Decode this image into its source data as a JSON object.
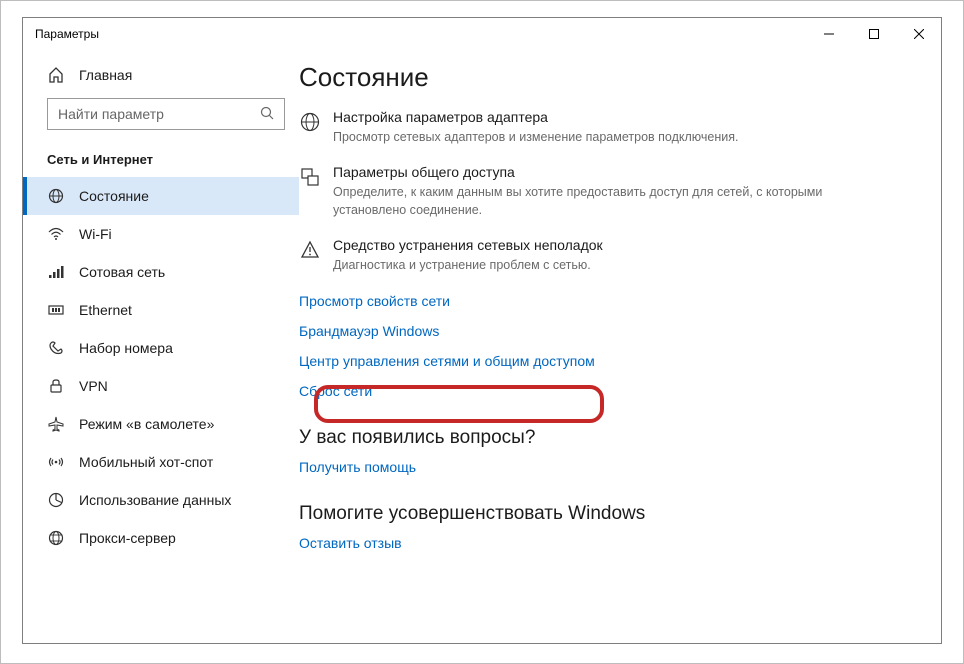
{
  "window": {
    "title": "Параметры"
  },
  "sidebar": {
    "home": "Главная",
    "search_placeholder": "Найти параметр",
    "group": "Сеть и Интернет",
    "items": [
      {
        "label": "Состояние"
      },
      {
        "label": "Wi-Fi"
      },
      {
        "label": "Сотовая сеть"
      },
      {
        "label": "Ethernet"
      },
      {
        "label": "Набор номера"
      },
      {
        "label": "VPN"
      },
      {
        "label": "Режим «в самолете»"
      },
      {
        "label": "Мобильный хот-спот"
      },
      {
        "label": "Использование данных"
      },
      {
        "label": "Прокси-сервер"
      }
    ]
  },
  "main": {
    "title": "Состояние",
    "settings": [
      {
        "title": "Настройка параметров адаптера",
        "desc": "Просмотр сетевых адаптеров и изменение параметров подключения."
      },
      {
        "title": "Параметры общего доступа",
        "desc": "Определите, к каким данным вы хотите предоставить доступ для сетей, с которыми установлено соединение."
      },
      {
        "title": "Средство устранения сетевых неполадок",
        "desc": "Диагностика и устранение проблем с сетью."
      }
    ],
    "links": [
      "Просмотр свойств сети",
      "Брандмауэр Windows",
      "Центр управления сетями и общим доступом",
      "Сброс сети"
    ],
    "questions_heading": "У вас появились вопросы?",
    "get_help": "Получить помощь",
    "improve_heading": "Помогите усовершенствовать Windows",
    "feedback": "Оставить отзыв"
  }
}
